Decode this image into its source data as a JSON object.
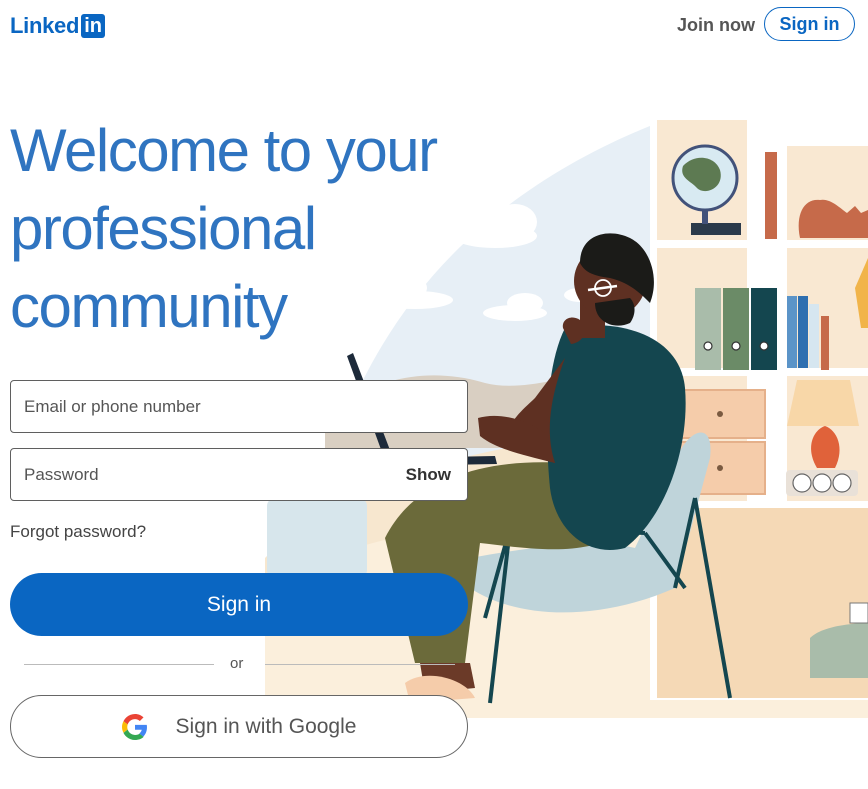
{
  "header": {
    "logo_text": "Linked",
    "logo_box_text": "in",
    "join_now": "Join now",
    "sign_in": "Sign in"
  },
  "hero": {
    "headline_line1": "Welcome to your",
    "headline_line2": "professional",
    "headline_line3": "community"
  },
  "form": {
    "email_placeholder": "Email or phone number",
    "email_value": "",
    "password_placeholder": "Password",
    "password_value": "",
    "show_label": "Show",
    "forgot_label": "Forgot password?",
    "sign_in_label": "Sign in",
    "or_label": "or",
    "google_label": "Sign in with Google"
  },
  "colors": {
    "brand": "#0a66c2",
    "headline": "#2f74c0"
  },
  "icons": {
    "google": "google-g-icon"
  }
}
